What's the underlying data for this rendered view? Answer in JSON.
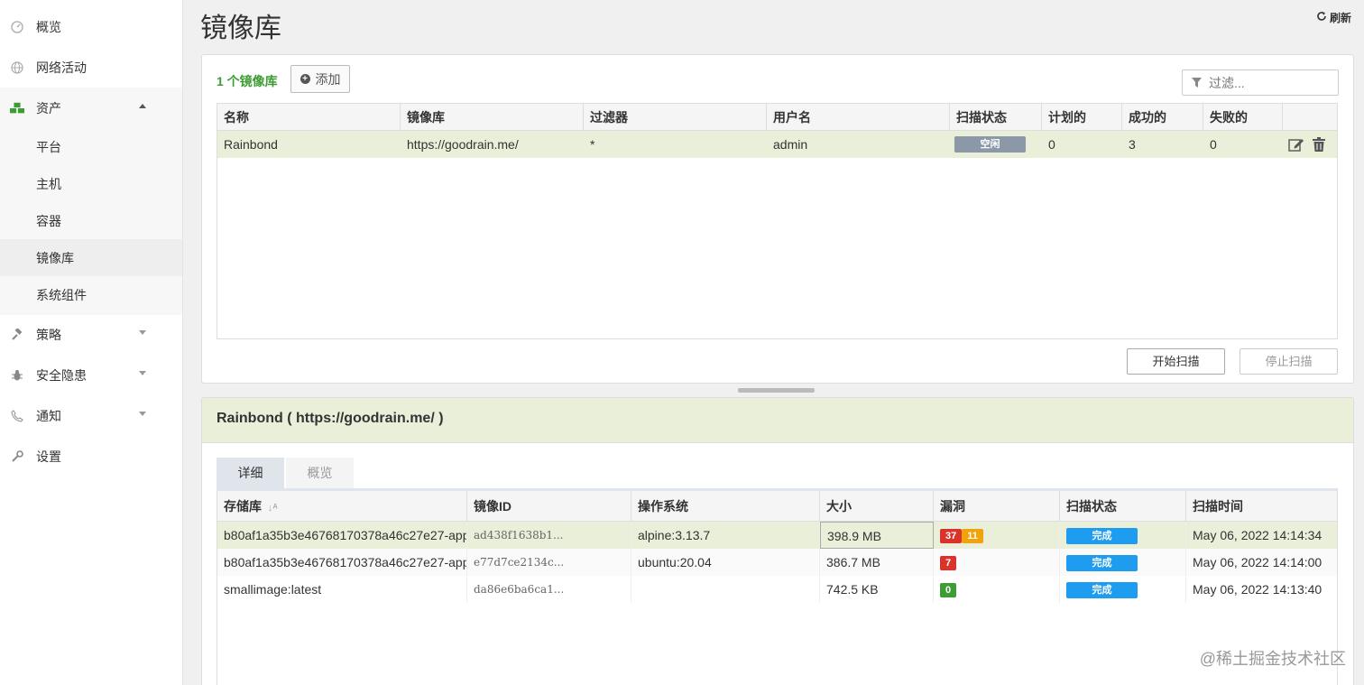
{
  "sidebar": {
    "items": [
      {
        "label": "概览",
        "icon": "dashboard-icon"
      },
      {
        "label": "网络活动",
        "icon": "globe-icon"
      },
      {
        "label": "资产",
        "icon": "cubes-icon"
      },
      {
        "label": "策略",
        "icon": "gavel-icon"
      },
      {
        "label": "安全隐患",
        "icon": "bug-icon"
      },
      {
        "label": "通知",
        "icon": "phone-icon"
      },
      {
        "label": "设置",
        "icon": "wrench-icon"
      }
    ],
    "sub_items": [
      "平台",
      "主机",
      "容器",
      "镜像库",
      "系统组件"
    ]
  },
  "header": {
    "title": "镜像库",
    "refresh_label": "刷新"
  },
  "registry_panel": {
    "count_label": "1 个镜像库",
    "add_label": "添加",
    "filter_placeholder": "过滤...",
    "columns": [
      "名称",
      "镜像库",
      "过滤器",
      "用户名",
      "扫描状态",
      "计划的",
      "成功的",
      "失败的"
    ],
    "rows": [
      {
        "name": "Rainbond",
        "registry": "https://goodrain.me/",
        "filter": "*",
        "username": "admin",
        "scan_status": "空闲",
        "scheduled": "0",
        "succeeded": "3",
        "failed": "0"
      }
    ],
    "start_scan_label": "开始扫描",
    "stop_scan_label": "停止扫描"
  },
  "detail_panel": {
    "title": "Rainbond ( https://goodrain.me/ )",
    "tabs": [
      "详细",
      "概览"
    ],
    "columns": [
      "存储库",
      "镜像ID",
      "操作系统",
      "大小",
      "漏洞",
      "扫描状态",
      "扫描时间"
    ],
    "rows": [
      {
        "repo": "b80af1a35b3e46768170378a46c27e27-app",
        "image_id": "ad438f1638b1...",
        "os": "alpine:3.13.7",
        "size": "398.9 MB",
        "vuln_high": "37",
        "vuln_med": "11",
        "status": "完成",
        "time": "May 06, 2022 14:14:34"
      },
      {
        "repo": "b80af1a35b3e46768170378a46c27e27-app",
        "image_id": "e77d7ce2134c...",
        "os": "ubuntu:20.04",
        "size": "386.7 MB",
        "vuln_high": "7",
        "vuln_med": "",
        "status": "完成",
        "time": "May 06, 2022 14:14:00"
      },
      {
        "repo": "smallimage:latest",
        "image_id": "da86e6ba6ca1...",
        "os": "",
        "size": "742.5 KB",
        "vuln_high": "0",
        "vuln_med": "",
        "status": "完成",
        "time": "May 06, 2022 14:13:40"
      }
    ]
  },
  "watermark": "@稀土掘金技术社区",
  "colors": {
    "accent_green": "#3f9c35",
    "row_highlight": "#e9efd9",
    "status_done": "#1e9cf0",
    "vuln_critical": "#d9342b",
    "vuln_high": "#f0a30a"
  }
}
